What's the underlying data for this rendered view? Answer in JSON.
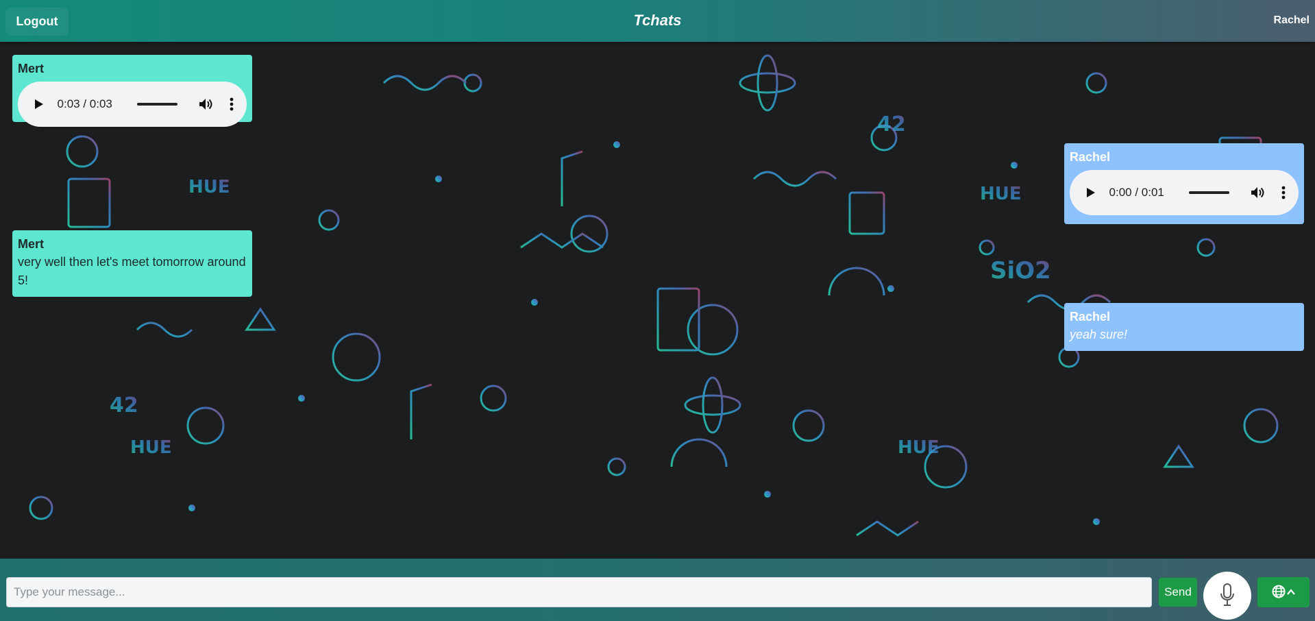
{
  "header": {
    "logout_label": "Logout",
    "app_title": "Tchats",
    "current_user": "Rachel"
  },
  "messages": [
    {
      "sender": "Mert",
      "type": "audio",
      "time": "0:03 / 0:03"
    },
    {
      "sender": "Mert",
      "type": "text",
      "text": "very well then let's meet tomorrow around 5!"
    },
    {
      "sender": "Rachel",
      "type": "audio",
      "time": "0:00 / 0:01"
    },
    {
      "sender": "Rachel",
      "type": "text",
      "text": "yeah sure!"
    }
  ],
  "footer": {
    "input_placeholder": "Type your message...",
    "input_value": "",
    "send_label": "Send",
    "mic_icon": "microphone-icon",
    "language_icon": "globe-icon",
    "language_caret_icon": "chevron-up-icon"
  },
  "colors": {
    "header_start": "#138a7a",
    "header_end": "#4a5d6e",
    "mert_bubble": "#5de6d0",
    "rachel_bubble": "#8ec2ff",
    "send_button": "#1c9a45",
    "background": "#1c1d1f"
  }
}
